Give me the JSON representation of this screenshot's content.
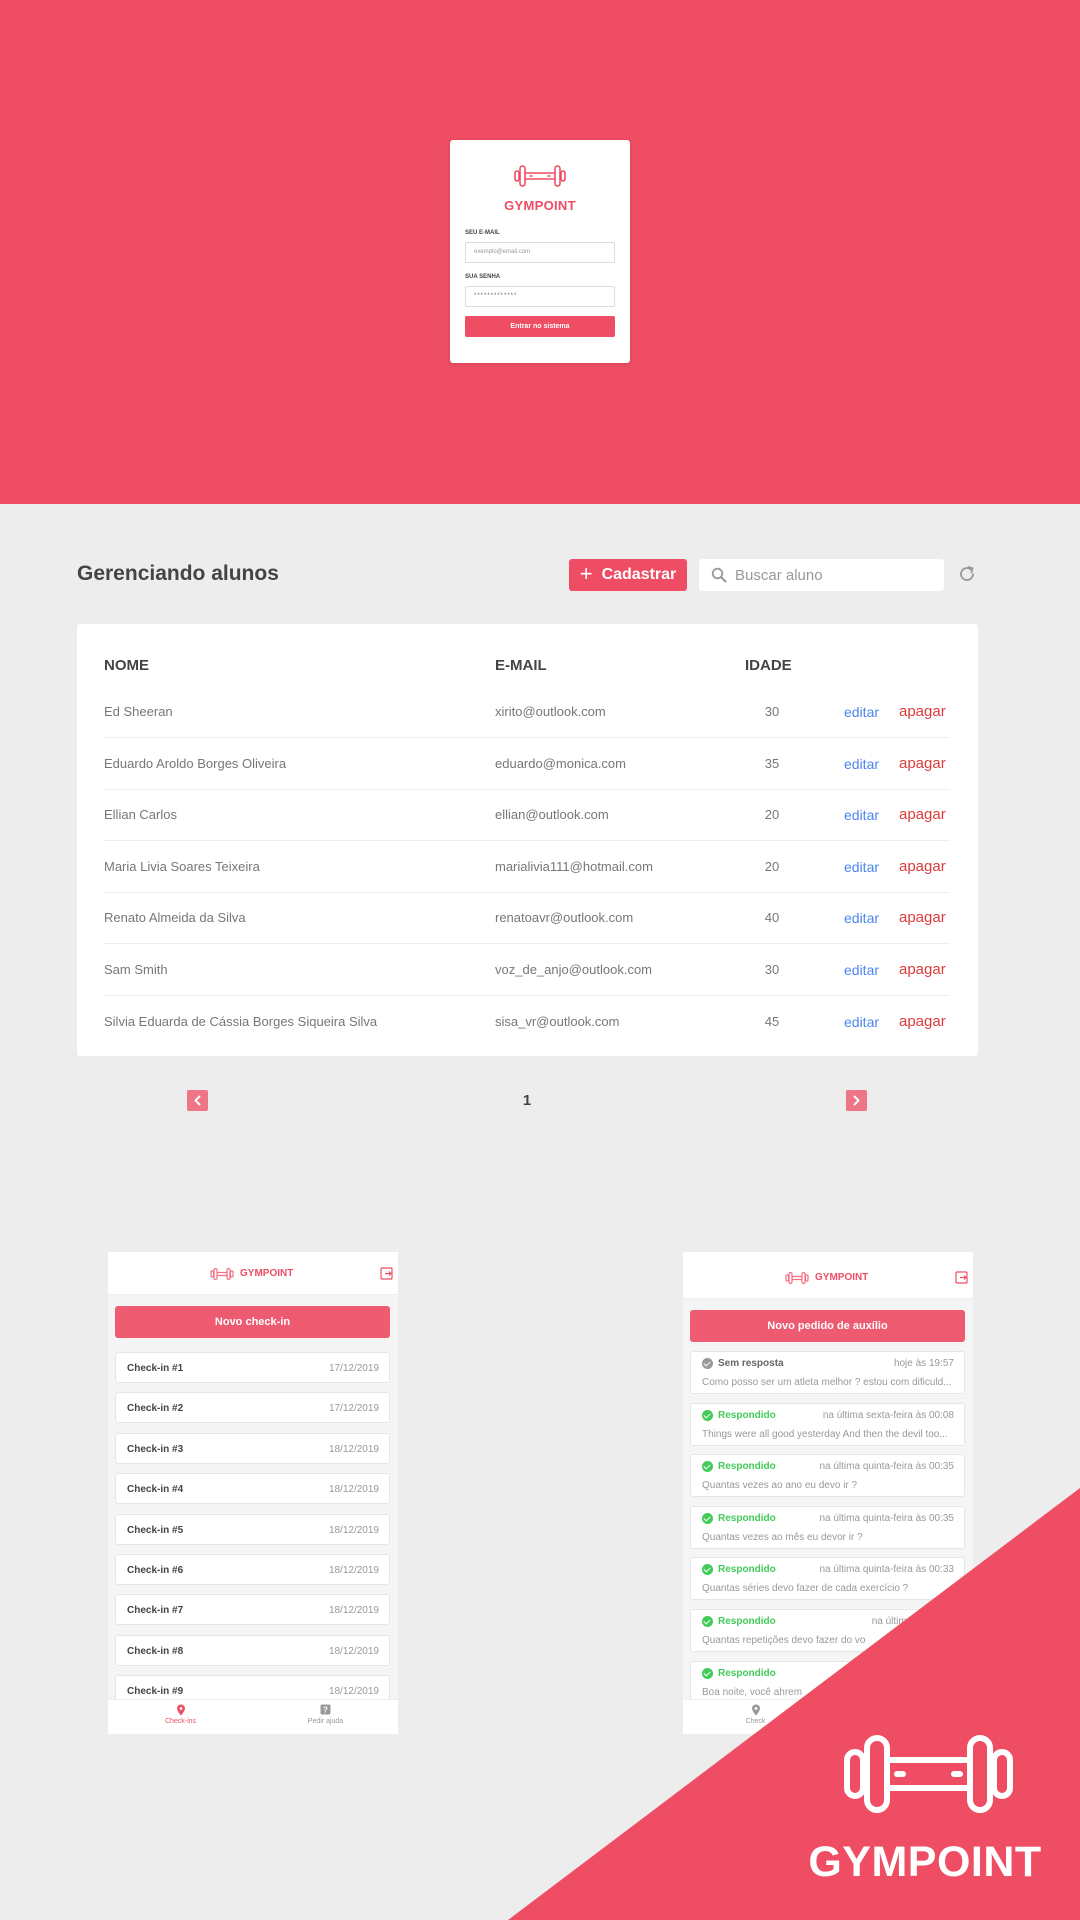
{
  "brand": {
    "name": "GYMPOINT",
    "primary_color": "#ee4d64",
    "background_color": "#ededed"
  },
  "login": {
    "email_label": "SEU E-MAIL",
    "email_placeholder": "exemplo@email.com",
    "password_label": "SUA SENHA",
    "password_value": "*************",
    "submit_label": "Entrar no sistema",
    "logo_icon": "dumbbell-icon"
  },
  "students": {
    "title": "Gerenciando alunos",
    "register_label": "Cadastrar",
    "search_placeholder": "Buscar aluno",
    "columns": {
      "name": "NOME",
      "email": "E-MAIL",
      "age": "IDADE"
    },
    "edit_label": "editar",
    "delete_label": "apagar",
    "edit_color": "#4d85ee",
    "delete_color": "#de3b3b",
    "rows": [
      {
        "name": "Ed Sheeran",
        "email": "xirito@outlook.com",
        "age": "30"
      },
      {
        "name": "Eduardo Aroldo Borges Oliveira",
        "email": "eduardo@monica.com",
        "age": "35"
      },
      {
        "name": "Ellian Carlos",
        "email": "ellian@outlook.com",
        "age": "20"
      },
      {
        "name": "Maria Livia Soares Teixeira",
        "email": "marialivia111@hotmail.com",
        "age": "20"
      },
      {
        "name": "Renato Almeida da Silva",
        "email": "renatoavr@outlook.com",
        "age": "40"
      },
      {
        "name": "Sam Smith",
        "email": "voz_de_anjo@outlook.com",
        "age": "30"
      },
      {
        "name": "Silvia Eduarda de Cássia Borges Siqueira Silva",
        "email": "sisa_vr@outlook.com",
        "age": "45"
      }
    ],
    "page": "1"
  },
  "checkins_app": {
    "brand": "GYMPOINT",
    "cta_label": "Novo check-in",
    "items": [
      {
        "title": "Check-in #1",
        "date": "17/12/2019"
      },
      {
        "title": "Check-in #2",
        "date": "17/12/2019"
      },
      {
        "title": "Check-in #3",
        "date": "18/12/2019"
      },
      {
        "title": "Check-in #4",
        "date": "18/12/2019"
      },
      {
        "title": "Check-in #5",
        "date": "18/12/2019"
      },
      {
        "title": "Check-in #6",
        "date": "18/12/2019"
      },
      {
        "title": "Check-in #7",
        "date": "18/12/2019"
      },
      {
        "title": "Check-in #8",
        "date": "18/12/2019"
      },
      {
        "title": "Check-in #9",
        "date": "18/12/2019"
      }
    ],
    "tabs": [
      {
        "label": "Check-ins",
        "icon": "map-pin-icon",
        "active": true
      },
      {
        "label": "Pedir ajuda",
        "icon": "help-icon",
        "active": false
      }
    ]
  },
  "help_app": {
    "brand": "GYMPOINT",
    "cta_label": "Novo pedido de auxílio",
    "answered_color": "#42cb59",
    "unanswered_color": "#999999",
    "items": [
      {
        "status": "Sem resposta",
        "answered": false,
        "time": "hoje às 19:57",
        "question": "Como posso ser um atleta melhor ? estou com dificuld..."
      },
      {
        "status": "Respondido",
        "answered": true,
        "time": "na última sexta-feira às 00:08",
        "question": "Things were all good yesterday And then the devil too..."
      },
      {
        "status": "Respondido",
        "answered": true,
        "time": "na última quinta-feira às 00:35",
        "question": "Quantas vezes ao ano eu devo ir ?"
      },
      {
        "status": "Respondido",
        "answered": true,
        "time": "na última quinta-feira às 00:35",
        "question": "Quantas vezes ao mês eu devor ir ?"
      },
      {
        "status": "Respondido",
        "answered": true,
        "time": "na última quinta-feira às 00:33",
        "question": "Quantas séries devo fazer de cada exercício ?"
      },
      {
        "status": "Respondido",
        "answered": true,
        "time": "na última quinta-fe",
        "question": "Quantas repetições devo fazer do vo"
      },
      {
        "status": "Respondido",
        "answered": true,
        "time": "na",
        "question": "Boa noite, você ahrem"
      }
    ],
    "tab_first_label": "Check"
  },
  "corner": {
    "brand": "GYMPOINT",
    "icon": "dumbbell-icon"
  }
}
